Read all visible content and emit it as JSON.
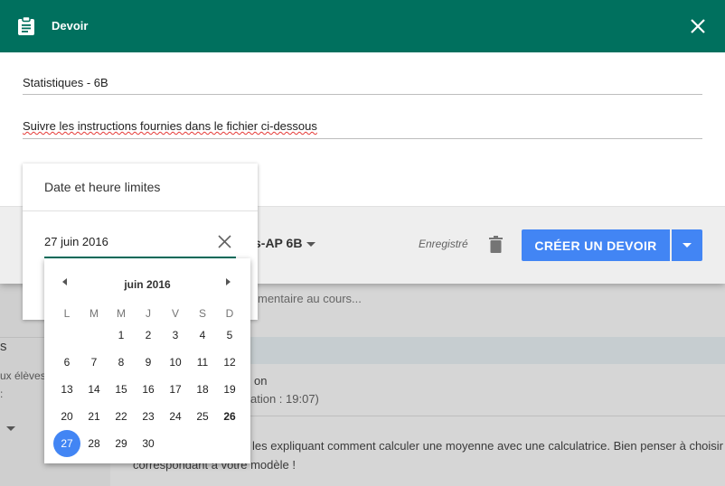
{
  "dialog": {
    "title": "Devoir",
    "title_field_value": "Statistiques - 6B",
    "instructions_field_value": "Suivre les instructions fournies dans le fichier ci-dessous",
    "class_selector_label": "s-AP 6B",
    "saved_status": "Enregistré",
    "create_button_label": "CRÉER UN DEVOIR",
    "header_color": "#00705e",
    "accent_color": "#4285f4"
  },
  "due_popup": {
    "title": "Date et heure limites",
    "date_value": "27 juin 2016"
  },
  "calendar": {
    "month_label": "juin 2016",
    "weekdays": [
      "L",
      "M",
      "M",
      "J",
      "V",
      "S",
      "D"
    ],
    "weeks": [
      [
        "",
        "",
        "1",
        "2",
        "3",
        "4",
        "5"
      ],
      [
        "6",
        "7",
        "8",
        "9",
        "10",
        "11",
        "12"
      ],
      [
        "13",
        "14",
        "15",
        "16",
        "17",
        "18",
        "19"
      ],
      [
        "20",
        "21",
        "22",
        "23",
        "24",
        "25",
        "26"
      ],
      [
        "27",
        "28",
        "29",
        "30",
        "",
        "",
        ""
      ]
    ],
    "selected_day": "27",
    "today_day": "26"
  },
  "background": {
    "comment_placeholder": "mentaire au cours...",
    "left_text_1": "s",
    "left_text_2": "ux élèves",
    "left_text_3": ":",
    "item_name": "on",
    "item_meta": "ation : 19:07)",
    "item_body_1": "les expliquant comment calculer une moyenne avec une calculatrice. Bien penser à choisir e",
    "item_body_2": "correspondant à votre modèle !"
  }
}
